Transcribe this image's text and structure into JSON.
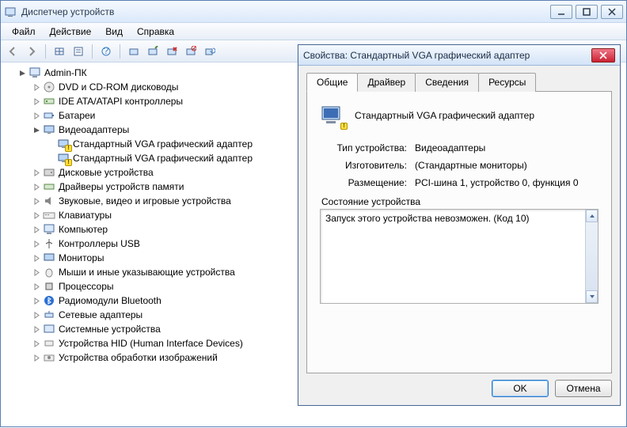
{
  "window": {
    "title": "Диспетчер устройств"
  },
  "menu": {
    "file": "Файл",
    "action": "Действие",
    "view": "Вид",
    "help": "Справка"
  },
  "tree": {
    "root": "Admin-ПК",
    "items": [
      {
        "label": "DVD и CD-ROM дисководы",
        "icon": "disc"
      },
      {
        "label": "IDE ATA/ATAPI контроллеры",
        "icon": "ctrl"
      },
      {
        "label": "Батареи",
        "icon": "battery"
      },
      {
        "label": "Видеоадаптеры",
        "icon": "display",
        "expanded": true,
        "children": [
          {
            "label": "Стандартный VGA графический адаптер",
            "warn": true
          },
          {
            "label": "Стандартный VGA графический адаптер",
            "warn": true
          }
        ]
      },
      {
        "label": "Дисковые устройства",
        "icon": "disk"
      },
      {
        "label": "Драйверы устройств памяти",
        "icon": "mem"
      },
      {
        "label": "Звуковые, видео и игровые устройства",
        "icon": "audio"
      },
      {
        "label": "Клавиатуры",
        "icon": "keyboard"
      },
      {
        "label": "Компьютер",
        "icon": "computer"
      },
      {
        "label": "Контроллеры USB",
        "icon": "usb"
      },
      {
        "label": "Мониторы",
        "icon": "monitor"
      },
      {
        "label": "Мыши и иные указывающие устройства",
        "icon": "mouse"
      },
      {
        "label": "Процессоры",
        "icon": "cpu"
      },
      {
        "label": "Радиомодули Bluetooth",
        "icon": "bt"
      },
      {
        "label": "Сетевые адаптеры",
        "icon": "net"
      },
      {
        "label": "Системные устройства",
        "icon": "sys"
      },
      {
        "label": "Устройства HID (Human Interface Devices)",
        "icon": "hid"
      },
      {
        "label": "Устройства обработки изображений",
        "icon": "imaging"
      }
    ]
  },
  "dialog": {
    "title": "Свойства: Стандартный VGA графический адаптер",
    "tabs": {
      "general": "Общие",
      "driver": "Драйвер",
      "details": "Сведения",
      "resources": "Ресурсы"
    },
    "device_name": "Стандартный VGA графический адаптер",
    "labels": {
      "type": "Тип устройства:",
      "manufacturer": "Изготовитель:",
      "location": "Размещение:",
      "status_header": "Состояние устройства"
    },
    "values": {
      "type": "Видеоадаптеры",
      "manufacturer": "(Стандартные мониторы)",
      "location": "PCI-шина 1, устройство 0, функция 0"
    },
    "status_text": "Запуск этого устройства невозможен. (Код 10)",
    "buttons": {
      "ok": "OK",
      "cancel": "Отмена"
    }
  }
}
